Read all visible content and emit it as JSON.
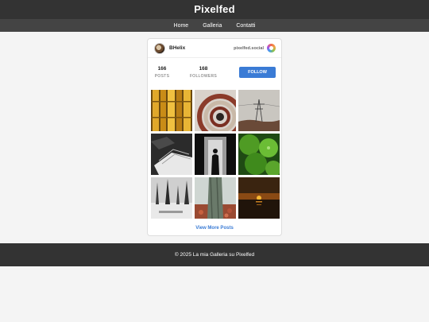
{
  "header": {
    "title": "Pixelfed"
  },
  "nav": {
    "items": [
      "Home",
      "Galleria",
      "Contatti"
    ]
  },
  "profile": {
    "username": "BHelix",
    "instance": "pixelfed.social",
    "posts_count": "166",
    "posts_label": "POSTS",
    "followers_count": "168",
    "followers_label": "FOLLOWERS",
    "follow_label": "FOLLOW"
  },
  "gallery": {
    "photos": [
      {
        "subject": "bamboo"
      },
      {
        "subject": "spiral-staircase"
      },
      {
        "subject": "power-pylon"
      },
      {
        "subject": "book-pages"
      },
      {
        "subject": "tunnel-silhouette"
      },
      {
        "subject": "green-leaves"
      },
      {
        "subject": "snowy-trees"
      },
      {
        "subject": "tree-trunk-leaves"
      },
      {
        "subject": "sunset-water"
      }
    ],
    "view_more_label": "View More Posts"
  },
  "footer": {
    "text": "© 2025 La mia Galleria su Pixelfed"
  },
  "colors": {
    "header_bg": "#333333",
    "nav_bg": "#444444",
    "accent": "#3a7bd5",
    "page_bg": "#f4f4f4"
  }
}
